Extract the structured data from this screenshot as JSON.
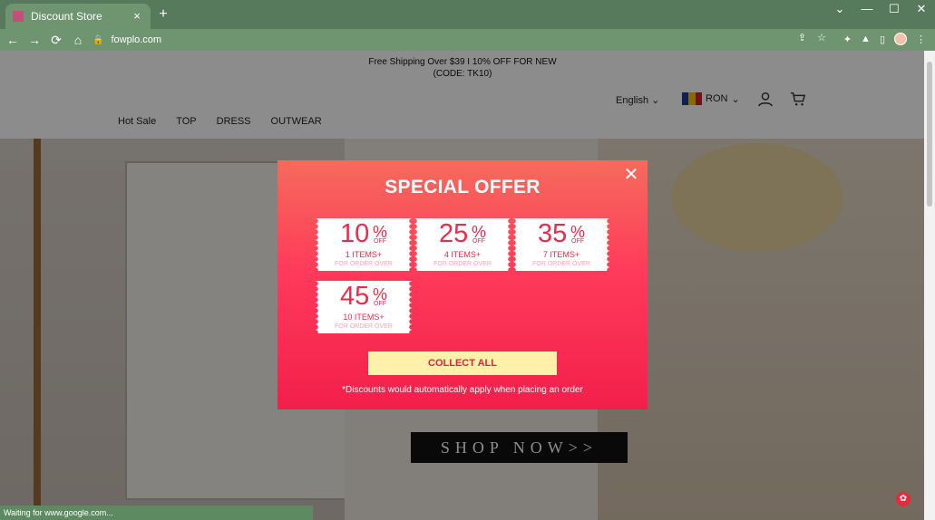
{
  "browser": {
    "tab_title": "Discount Store",
    "url": "fowplo.com"
  },
  "page": {
    "announcement_line1": "Free Shipping Over $39 I 10% OFF FOR NEW",
    "announcement_line2": "(CODE: TK10)",
    "language": "English",
    "currency": "RON",
    "nav": [
      "Hot Sale",
      "TOP",
      "DRESS",
      "OUTWEAR"
    ],
    "shop_now": "SHOP NOW>>"
  },
  "modal": {
    "title": "SPECIAL OFFER",
    "coupons": [
      {
        "percent": "10",
        "off": "OFF",
        "items": "1 ITEMS+",
        "note": "FOR ORDER OVER"
      },
      {
        "percent": "25",
        "off": "OFF",
        "items": "4 ITEMS+",
        "note": "FOR ORDER OVER"
      },
      {
        "percent": "35",
        "off": "OFF",
        "items": "7 ITEMS+",
        "note": "FOR ORDER OVER"
      },
      {
        "percent": "45",
        "off": "OFF",
        "items": "10 ITEMS+",
        "note": "FOR ORDER OVER"
      }
    ],
    "collect_label": "COLLECT ALL",
    "disclaimer": "*Discounts would automatically apply when placing an order"
  },
  "status": {
    "text": "Waiting for www.google.com..."
  },
  "colors": {
    "chrome_green": "#577a5c",
    "modal_red": "#f21f4b",
    "collect_bg": "#fff1a9"
  }
}
